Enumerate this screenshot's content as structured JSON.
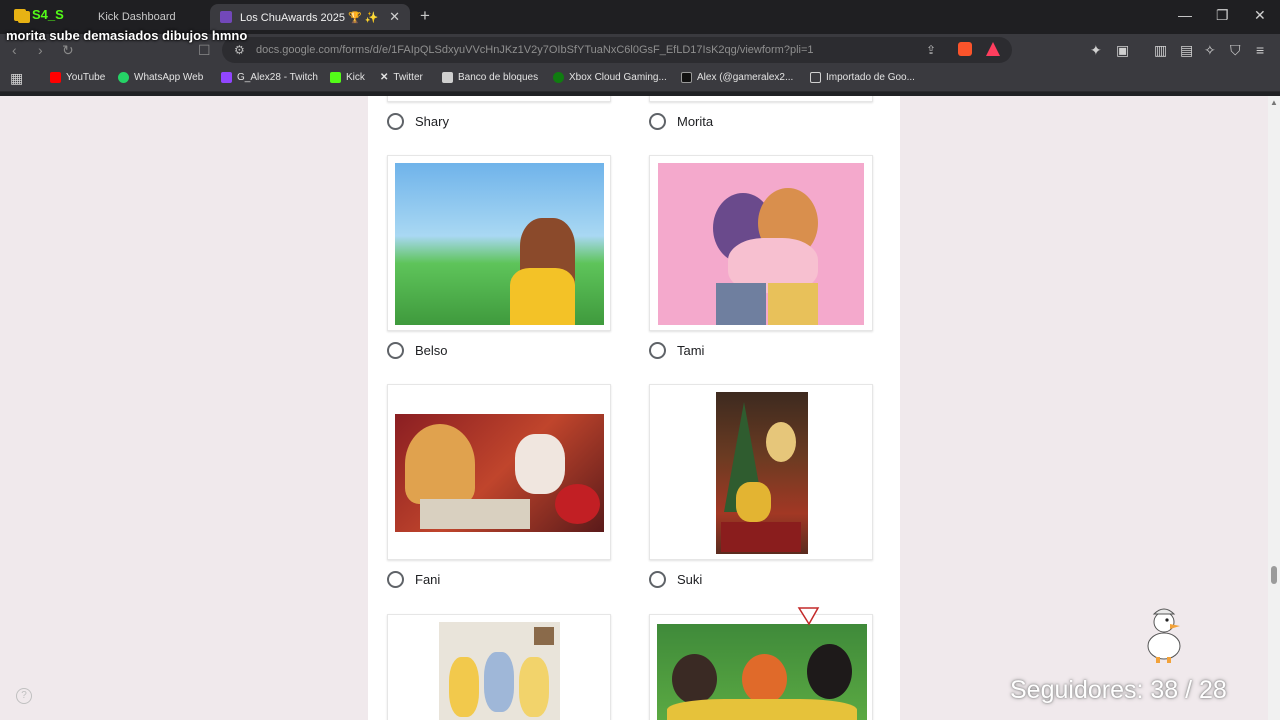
{
  "stream": {
    "badge": "S4_S",
    "title": "morita sube demasiados dibujos hmno",
    "followers": "Seguidores: 38 / 28"
  },
  "browser": {
    "tabs": [
      {
        "label": "Kick Dashboard"
      },
      {
        "label": "Los ChuAwards 2025 🏆 ✨"
      }
    ],
    "url": "docs.google.com/forms/d/e/1FAIpQLSdxyuVVcHnJKz1V2y7OIbSfYTuaNxC6l0GsF_EfLD17IsK2qg/viewform?pli=1",
    "bookmarks": [
      {
        "label": "YouTube",
        "color": "#ff0000"
      },
      {
        "label": "WhatsApp Web",
        "color": "#25d366"
      },
      {
        "label": "G_Alex28 - Twitch",
        "color": "#9146ff"
      },
      {
        "label": "Kick",
        "color": "#53fc18"
      },
      {
        "label": "Twitter",
        "color": "#ffffff"
      },
      {
        "label": "Banco de bloques",
        "color": "#cfcfcf"
      },
      {
        "label": "Xbox Cloud Gaming...",
        "color": "#107c10"
      },
      {
        "label": "Alex (@gameralex2...",
        "color": "#111111"
      },
      {
        "label": "Importado de Goo...",
        "color": "#d0d0d0"
      }
    ]
  },
  "form": {
    "options": [
      {
        "label": "Shary"
      },
      {
        "label": "Morita"
      },
      {
        "label": "Belso"
      },
      {
        "label": "Tami"
      },
      {
        "label": "Fani"
      },
      {
        "label": "Suki"
      }
    ]
  }
}
